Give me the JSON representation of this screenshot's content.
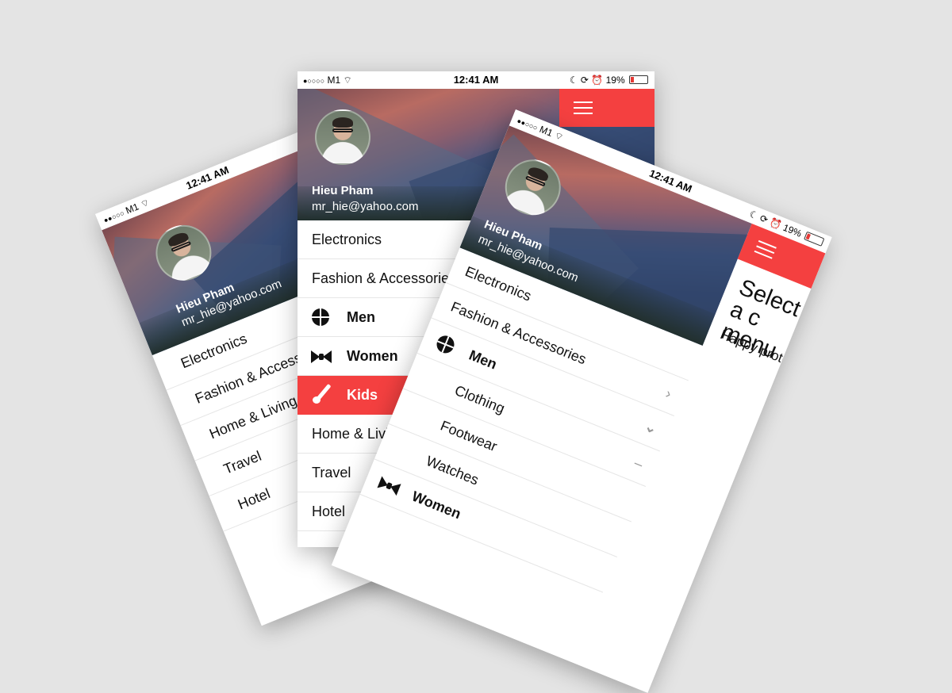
{
  "status": {
    "carrier": "M1",
    "signal": "●●○○○",
    "wifi_icon": "wifi-icon",
    "time": "12:41 AM",
    "battery": "19%",
    "accent": "#f44040"
  },
  "user": {
    "name": "Hieu Pham",
    "email": "mr_hie@yahoo.com"
  },
  "left_phone": {
    "status": {
      "signal": "●●○○○",
      "carrier": "M1",
      "time": "12:41 AM"
    },
    "user": {
      "name": "Hieu Pham",
      "email": "mr_hie@yahoo.com"
    },
    "menu": [
      "Electronics",
      "Fashion & Accessories",
      "Home & Living",
      "Travel",
      "Hotel"
    ]
  },
  "middle_phone": {
    "status": {
      "signal": "●○○○○",
      "carrier": "M1",
      "time": "12:41 AM",
      "battery": "19%"
    },
    "user": {
      "name": "Hieu Pham",
      "email": "mr_hie@yahoo.com"
    },
    "menu": [
      "Electronics",
      "Fashion & Accessories",
      "Men",
      "Women",
      "Kids",
      "Home & Living",
      "Travel",
      "Hotel"
    ],
    "active_item": "Kids"
  },
  "right_phone": {
    "status": {
      "signal": "●●○○○",
      "carrier": "M1",
      "time": "12:41 AM",
      "battery": "19%"
    },
    "user": {
      "name": "Hieu Pham",
      "email": "mr_hie@yahoo.com"
    },
    "menu": [
      "Electronics",
      "Fashion & Accessories",
      "Men",
      "Clothing",
      "Footwear",
      "Watches",
      "Women"
    ],
    "content_title": "Select a c menu",
    "content_sub": "Happy prototy"
  }
}
